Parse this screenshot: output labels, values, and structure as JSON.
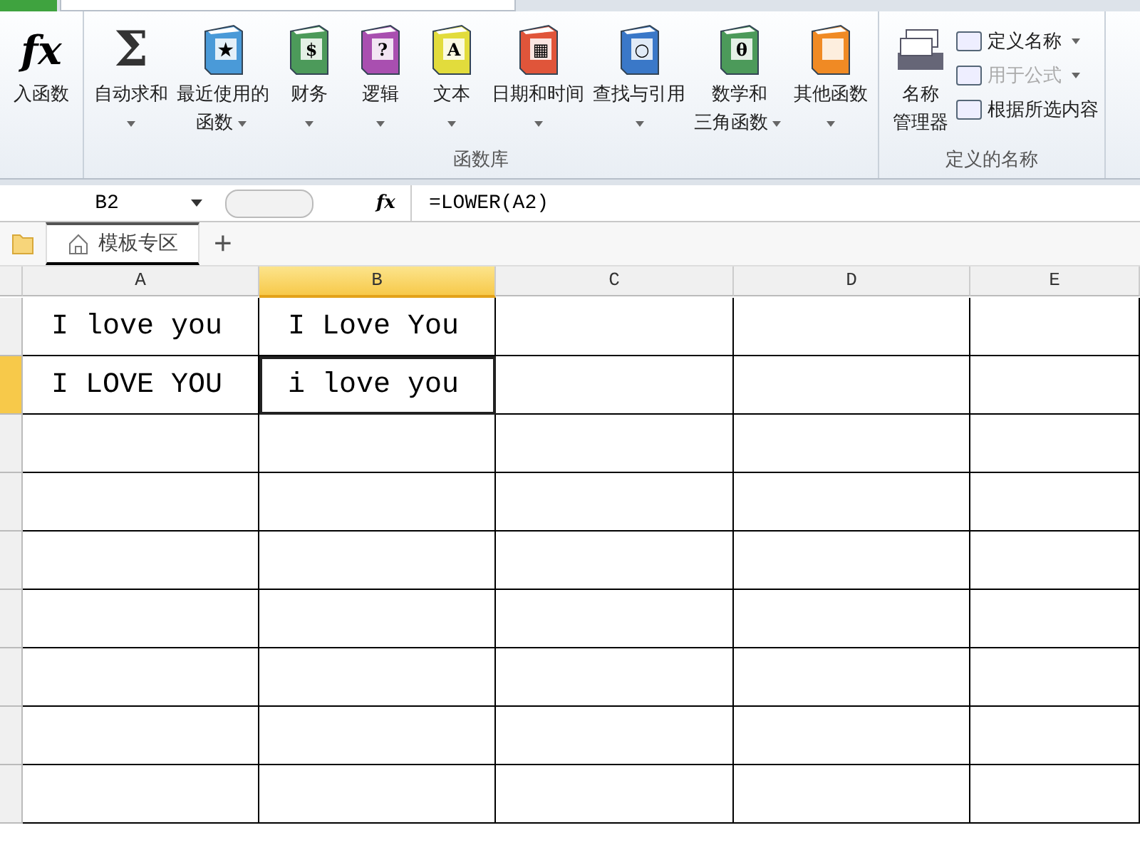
{
  "ribbon": {
    "groups": [
      {
        "buttons": [
          {
            "kind": "fx",
            "glyph": "fx",
            "lines": [
              "入函数"
            ],
            "has_menu": false
          }
        ]
      },
      {
        "label": "函数库",
        "buttons": [
          {
            "kind": "sigma",
            "glyph": "Σ",
            "lines": [
              "自动求和"
            ],
            "has_menu": true
          },
          {
            "kind": "book",
            "color": "#4a9ad8",
            "glyph": "★",
            "lines": [
              "最近使用的",
              "函数"
            ],
            "has_menu": true
          },
          {
            "kind": "book",
            "color": "#4c9a5a",
            "glyph": "$",
            "lines": [
              "财务"
            ],
            "has_menu": true
          },
          {
            "kind": "book",
            "color": "#a94fb0",
            "glyph": "?",
            "lines": [
              "逻辑"
            ],
            "has_menu": true
          },
          {
            "kind": "book",
            "color": "#e2dc3c",
            "glyph": "A",
            "lines": [
              "文本"
            ],
            "has_menu": true
          },
          {
            "kind": "book",
            "color": "#e0553a",
            "glyph": "▦",
            "lines": [
              "日期和时间"
            ],
            "has_menu": true
          },
          {
            "kind": "book",
            "color": "#3a78c8",
            "glyph": "○",
            "lines": [
              "查找与引用"
            ],
            "has_menu": true
          },
          {
            "kind": "book",
            "color": "#4c9a5a",
            "glyph": "θ",
            "lines": [
              "数学和",
              "三角函数"
            ],
            "has_menu": true
          },
          {
            "kind": "book",
            "color": "#f08a24",
            "lines": [
              "其他函数"
            ],
            "has_menu": true
          }
        ]
      },
      {
        "label": "定义的名称",
        "buttons": [
          {
            "kind": "names",
            "lines": [
              "名称",
              "管理器"
            ],
            "has_menu": false
          }
        ],
        "small_buttons": [
          {
            "label": "定义名称",
            "has_menu": true,
            "disabled": false
          },
          {
            "label": "用于公式",
            "has_menu": true,
            "disabled": true
          },
          {
            "label": "根据所选内容",
            "has_menu": false,
            "disabled": false
          }
        ]
      }
    ]
  },
  "formula_bar": {
    "name_box": "B2",
    "fx": "fx",
    "formula": "=LOWER(A2)"
  },
  "tabs": [
    {
      "label": "模板专区"
    }
  ],
  "new_tab": "+",
  "sheet": {
    "columns": [
      {
        "label": "A",
        "selected": false
      },
      {
        "label": "B",
        "selected": true
      },
      {
        "label": "C",
        "selected": false
      },
      {
        "label": "D",
        "selected": false
      },
      {
        "label": "E",
        "selected": false
      }
    ],
    "rows": [
      {
        "selected": false,
        "cells": [
          {
            "text": "I love you",
            "active": false
          },
          {
            "text": "I Love You",
            "active": false
          },
          {
            "active": false
          },
          {
            "active": false
          },
          {
            "active": false
          }
        ]
      },
      {
        "selected": true,
        "cells": [
          {
            "text": "I LOVE YOU",
            "active": false
          },
          {
            "text": "i love you",
            "active": true
          },
          {
            "active": false
          },
          {
            "active": false
          },
          {
            "active": false
          }
        ]
      },
      {
        "selected": false,
        "cells": [
          {
            "active": false
          },
          {
            "active": false
          },
          {
            "active": false
          },
          {
            "active": false
          },
          {
            "active": false
          }
        ]
      },
      {
        "selected": false,
        "cells": [
          {
            "active": false
          },
          {
            "active": false
          },
          {
            "active": false
          },
          {
            "active": false
          },
          {
            "active": false
          }
        ]
      },
      {
        "selected": false,
        "cells": [
          {
            "active": false
          },
          {
            "active": false
          },
          {
            "active": false
          },
          {
            "active": false
          },
          {
            "active": false
          }
        ]
      },
      {
        "selected": false,
        "cells": [
          {
            "active": false
          },
          {
            "active": false
          },
          {
            "active": false
          },
          {
            "active": false
          },
          {
            "active": false
          }
        ]
      },
      {
        "selected": false,
        "cells": [
          {
            "active": false
          },
          {
            "active": false
          },
          {
            "active": false
          },
          {
            "active": false
          },
          {
            "active": false
          }
        ]
      },
      {
        "selected": false,
        "cells": [
          {
            "active": false
          },
          {
            "active": false
          },
          {
            "active": false
          },
          {
            "active": false
          },
          {
            "active": false
          }
        ]
      },
      {
        "selected": false,
        "cells": [
          {
            "active": false
          },
          {
            "active": false
          },
          {
            "active": false
          },
          {
            "active": false
          },
          {
            "active": false
          }
        ]
      }
    ]
  }
}
